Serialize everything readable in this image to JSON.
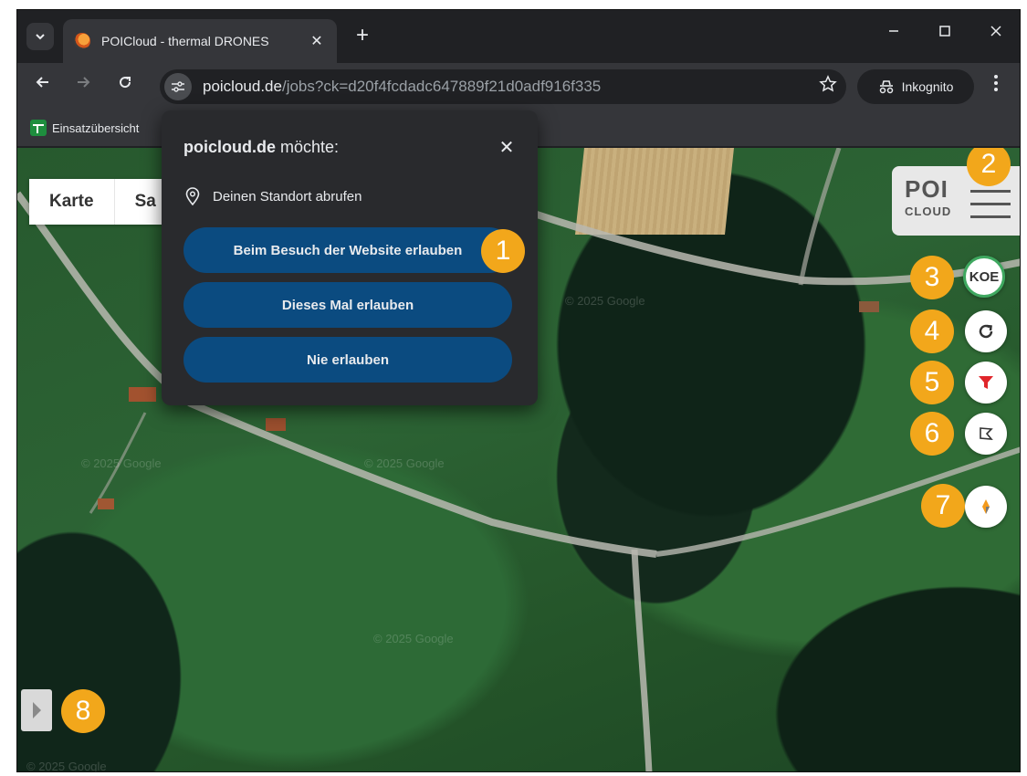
{
  "browser": {
    "tab_title": "POICloud - thermal DRONES",
    "tab_close": "✕",
    "new_tab": "+",
    "url_host": "poicloud.de",
    "url_path": "/jobs?ck=d20f4fcdadc647889f21d0adf916f335",
    "incognito_label": "Inkognito",
    "bookmark_label": "Einsatzübersicht"
  },
  "map": {
    "layer_tabs": [
      "Karte",
      "Sa"
    ],
    "brand_poi": "POI",
    "brand_cloud": "CLOUD",
    "koe_label": "KOE",
    "watermark": "© 2025 Google"
  },
  "popup": {
    "title_host": "poicloud.de",
    "title_suffix": " möchte:",
    "close": "✕",
    "permission_text": "Deinen Standort abrufen",
    "btn_always": "Beim Besuch der Website erlauben",
    "btn_once": "Dieses Mal erlauben",
    "btn_never": "Nie erlauben"
  },
  "badges": [
    "1",
    "2",
    "3",
    "4",
    "5",
    "6",
    "7",
    "8"
  ],
  "colors": {
    "badge": "#f2a71b",
    "popup_button": "#0b4b80",
    "koe_ring": "#3fa860",
    "filter_red": "#e0262b"
  }
}
